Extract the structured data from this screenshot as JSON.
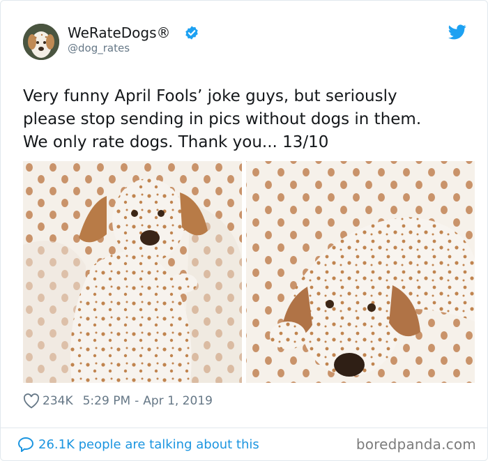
{
  "tweet": {
    "author_name": "WeRateDogs®",
    "handle": "@dog_rates",
    "text_lines": [
      "Very funny April Fools’ joke guys, but seriously",
      "please stop sending in pics without dogs in them.",
      "We only rate dogs. Thank you... 13/10"
    ],
    "likes": "234K",
    "time": "5:29 PM",
    "separator": "-",
    "date": "Apr 1, 2019",
    "talking": "26.1K people are talking about this"
  },
  "icons": {
    "verified": "verified-badge-icon",
    "platform": "twitter-bird-icon",
    "like": "heart-icon",
    "reply": "speech-bubble-icon"
  },
  "watermark": "boredpanda.com",
  "colors": {
    "accent_blue": "#1da1f2",
    "link_blue": "#1b95e0",
    "muted_gray": "#657786",
    "text": "#14171a",
    "border": "#e1e8ed"
  }
}
